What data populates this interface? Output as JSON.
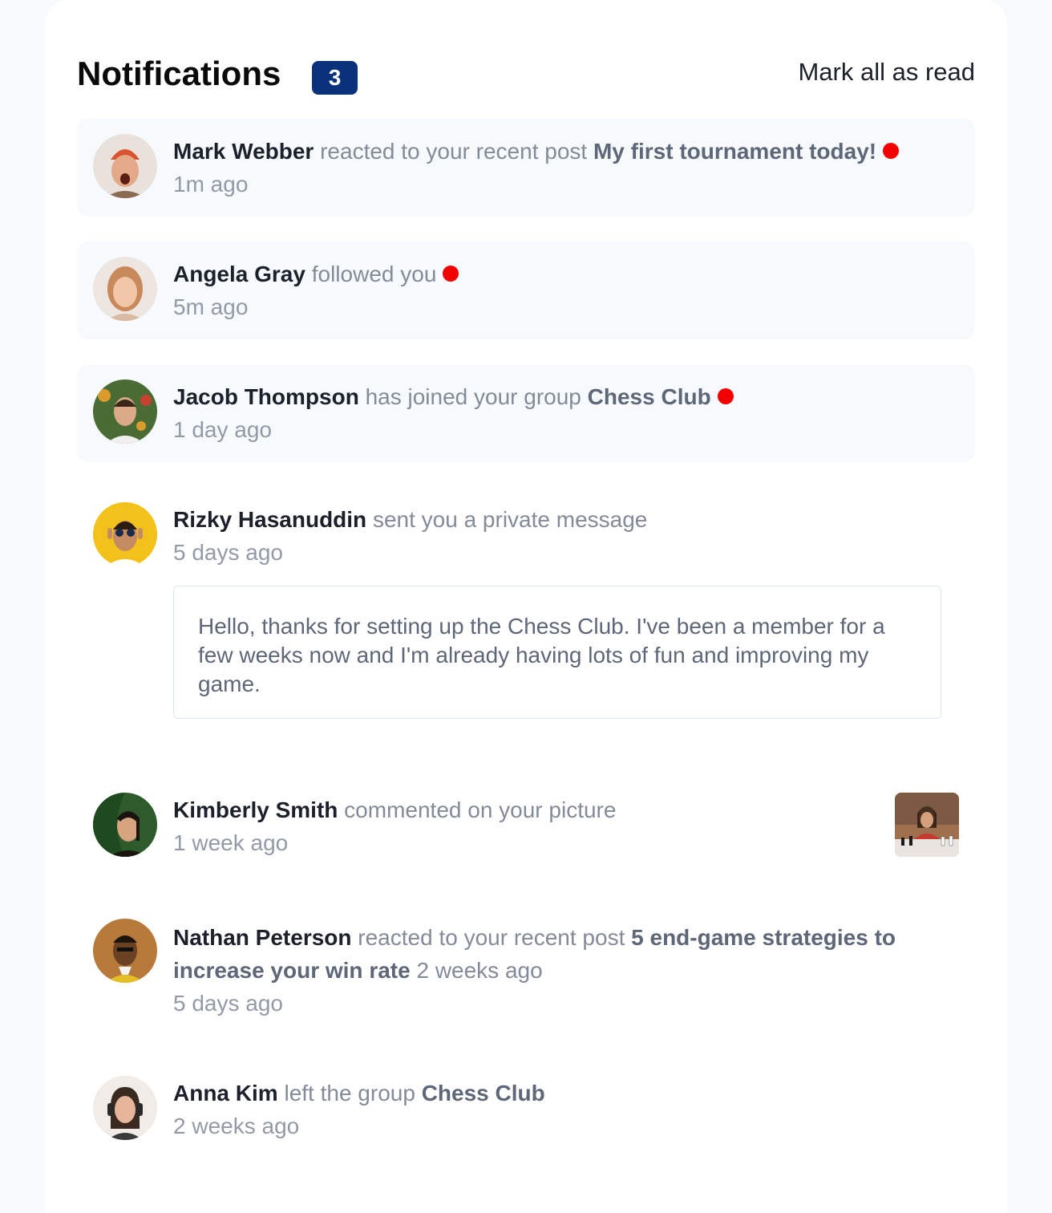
{
  "header": {
    "title": "Notifications",
    "unread_count": "3",
    "mark_all_label": "Mark all as read"
  },
  "notifications": [
    {
      "user": "Mark Webber",
      "action": "reacted to your recent post",
      "target": "My first tournament today!",
      "time": "1m ago",
      "unread": true
    },
    {
      "user": "Angela Gray",
      "action": "followed you",
      "time": "5m ago",
      "unread": true
    },
    {
      "user": "Jacob Thompson",
      "action": "has joined your group",
      "target": "Chess Club",
      "time": "1 day ago",
      "unread": true
    },
    {
      "user": "Rizky Hasanuddin",
      "action": "sent you a private message",
      "time": "5 days ago",
      "unread": false,
      "message": "Hello, thanks for setting up the Chess Club. I've been a member for a few weeks now and I'm already having lots of fun and improving my game."
    },
    {
      "user": "Kimberly Smith",
      "action": "commented on your picture",
      "time": "1 week ago",
      "unread": false
    },
    {
      "user": "Nathan Peterson",
      "action": "reacted to your recent post",
      "target": "5 end-game strategies to increase your win rate",
      "extra": "2 weeks ago",
      "time": "5 days ago",
      "unread": false
    },
    {
      "user": "Anna Kim",
      "action": "left the group",
      "target": "Chess Club",
      "time": "2 weeks ago",
      "unread": false
    }
  ],
  "colors": {
    "badge": "#0a327b",
    "unread_dot": "#f30000",
    "unread_bg": "#f7fafd",
    "name": "#1c202b",
    "muted": "#848b98"
  }
}
